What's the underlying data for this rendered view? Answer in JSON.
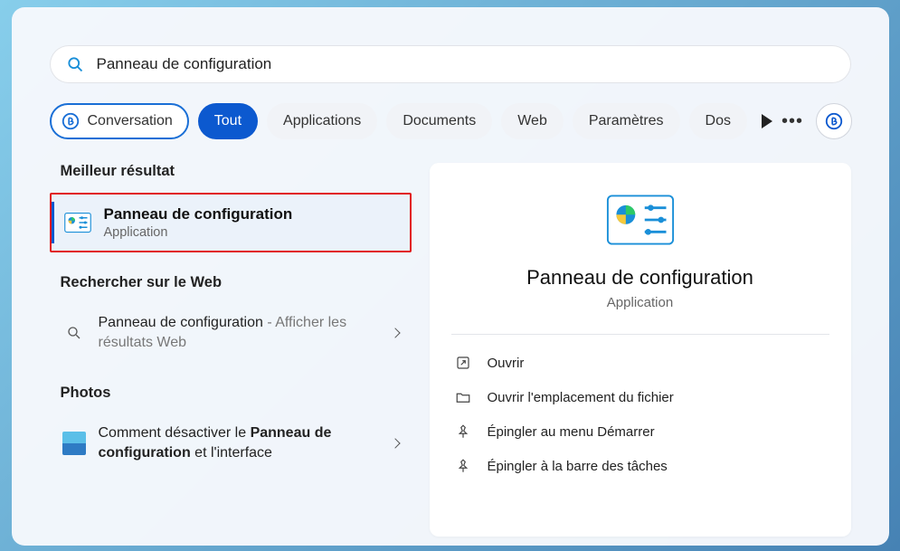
{
  "search": {
    "value": "Panneau de configuration"
  },
  "filters": {
    "conversation": "Conversation",
    "all": "Tout",
    "apps": "Applications",
    "docs": "Documents",
    "web": "Web",
    "settings": "Paramètres",
    "folders": "Dos"
  },
  "sections": {
    "best": "Meilleur résultat",
    "web": "Rechercher sur le Web",
    "photos": "Photos"
  },
  "best_result": {
    "title": "Panneau de configuration",
    "subtitle": "Application"
  },
  "web_result": {
    "prefix": "Panneau de configuration",
    "suffix": " - Afficher les résultats Web"
  },
  "photo_result": {
    "prefix1": "Comment désactiver le ",
    "bold": "Panneau de configuration",
    "suffix": " et l'interface"
  },
  "preview": {
    "title": "Panneau de configuration",
    "subtitle": "Application"
  },
  "actions": {
    "open": "Ouvrir",
    "open_location": "Ouvrir l'emplacement du fichier",
    "pin_start": "Épingler au menu Démarrer",
    "pin_taskbar": "Épingler à la barre des tâches"
  }
}
